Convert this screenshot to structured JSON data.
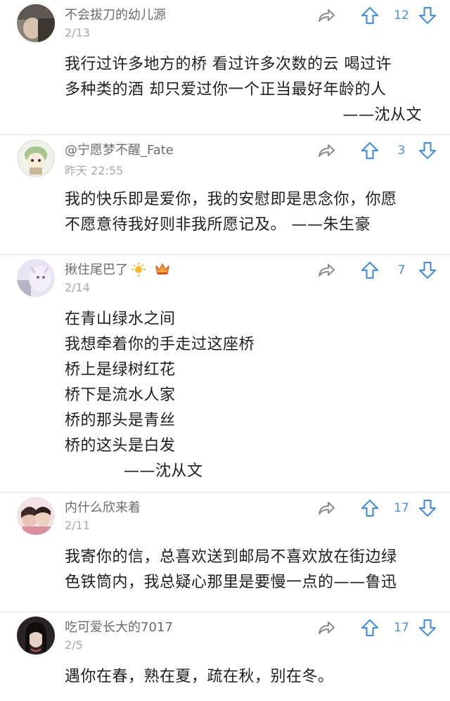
{
  "comments": [
    {
      "username": "不会拔刀的幼儿源",
      "date": "2/13",
      "upvotes": "12",
      "lines": [
        "我行过许多地方的桥 看过许多次数的云 喝过许",
        "多种类的酒 却只爱过你一个正当最好年龄的人",
        "——沈从文"
      ]
    },
    {
      "username": "@宁愿梦不醒_Fate",
      "date": "昨天 22:55",
      "upvotes": "3",
      "lines": [
        "我的快乐即是爱你，我的安慰即是思念你，你愿",
        "不愿意待我好则非我所愿记及。  ——朱生豪"
      ]
    },
    {
      "username": "揪住尾巴了",
      "date": "2/14",
      "upvotes": "7",
      "badges": [
        "sun-badge-icon",
        "crown-badge-icon"
      ],
      "lines": [
        "在青山绿水之间",
        "我想牵着你的手走过这座桥",
        "桥上是绿树红花",
        "桥下是流水人家",
        "桥的那头是青丝",
        "桥的这头是白发",
        "——沈从文"
      ]
    },
    {
      "username": "内什么欣来着",
      "date": "2/11",
      "upvotes": "17",
      "lines": [
        "我寄你的信，总喜欢送到邮局不喜欢放在街边绿",
        "色铁筒内，我总疑心那里是要慢一点的——鲁迅"
      ]
    },
    {
      "username": "吃可爱长大的7017",
      "date": "2/5",
      "upvotes": "17",
      "lines": [
        "遇你在春，熟在夏，疏在秋，别在冬。"
      ]
    }
  ],
  "colors": {
    "accent": "#4a90d9",
    "username": "#6b6b6b",
    "date": "#a8a8a8",
    "text": "#1e1e1e"
  },
  "icons": {
    "share": "share-icon",
    "upvote": "upvote-icon",
    "downvote": "downvote-icon"
  }
}
